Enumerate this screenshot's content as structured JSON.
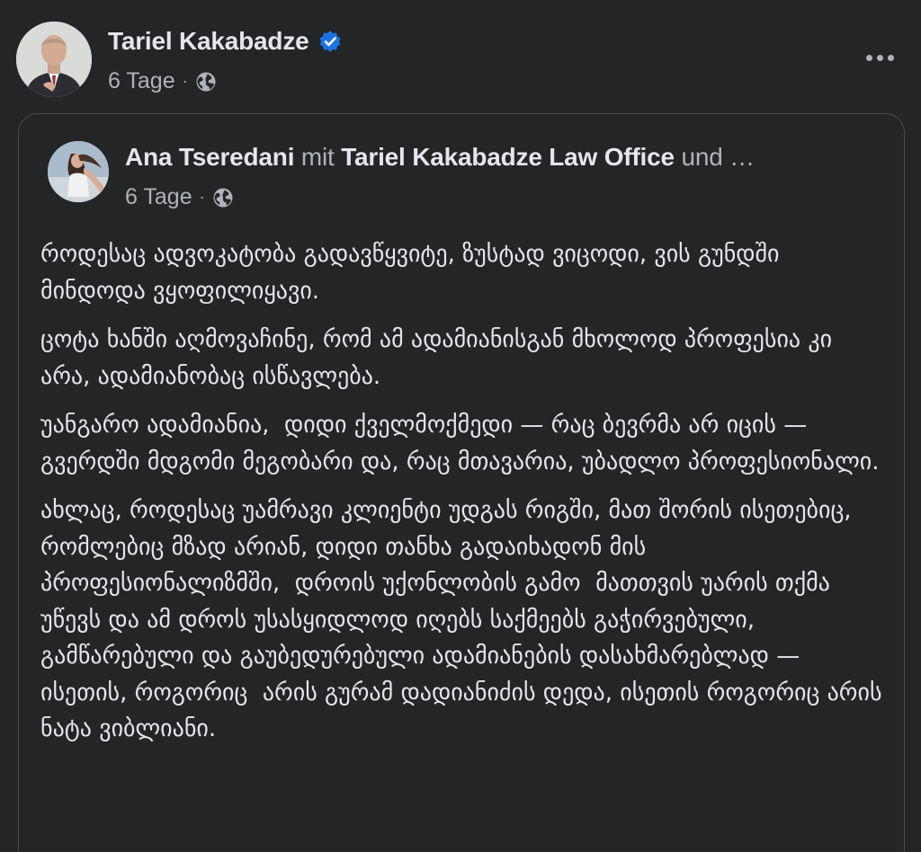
{
  "post": {
    "author": {
      "name": "Tariel Kakabadze",
      "verified": true,
      "time": "6 Tage",
      "separator": "·",
      "audience_icon": "globe-icon"
    },
    "more_icon": "more-horizontal-icon",
    "shared": {
      "author": "Ana Tseredani",
      "with_word": "mit",
      "tagged": "Tariel Kakabadze Law Office",
      "and_more": "und …",
      "time": "6 Tage",
      "separator": "·",
      "audience_icon": "globe-icon",
      "paragraphs": [
        "როდესაც ადვოკატობა გადავწყვიტე, ზუსტად ვიცოდი, ვის გუნდში მინდოდა ვყოფილიყავი.",
        "ცოტა ხანში აღმოვაჩინე, რომ ამ ადამიანისგან მხოლოდ პროფესია კი არა, ადამიანობაც ისწავლება.",
        "უანგარო ადამიანია,  დიდი ქველმოქმედი — რაც ბევრმა არ იცის — გვერდში მდგომი მეგობარი და, რაც მთავარია, უბადლო პროფესიონალი.",
        "ახლაც, როდესაც უამრავი კლიენტი უდგას რიგში, მათ შორის ისეთებიც, რომლებიც მზად არიან, დიდი თანხა გადაიხადონ მის პროფესიონალიზმში,  დროის უქონლობის გამო  მათთვის უარის თქმა უწევს და ამ დროს უსასყიდლოდ იღებს საქმეებს გაჭირვებული,  გამწარებული და გაუბედურებული ადამიანების დასახმარებლად — ისეთის, როგორიც  არის გურამ დადიანიძის დედა, ისეთის როგორიც არის ნატა ვიბლიანი."
      ]
    }
  }
}
